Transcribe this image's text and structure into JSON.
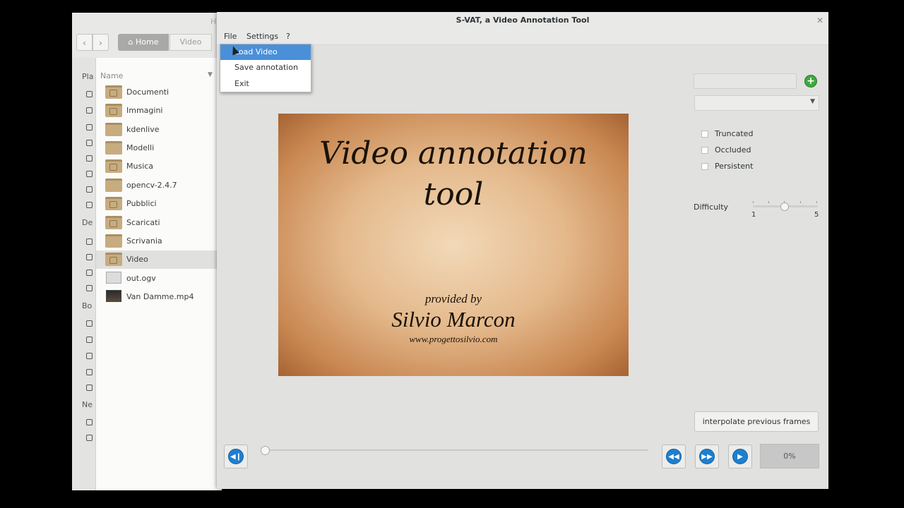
{
  "file_manager": {
    "title_fragment": "H",
    "back_icon": "chevron-left-icon",
    "forward_icon": "chevron-right-icon",
    "path": [
      "Home",
      "Video"
    ],
    "sidebar_sections": [
      "Pla",
      "De",
      "Bo",
      "Ne"
    ],
    "column_header": "Name",
    "items": [
      {
        "name": "Documenti",
        "type": "folder"
      },
      {
        "name": "Immagini",
        "type": "folder"
      },
      {
        "name": "kdenlive",
        "type": "folder"
      },
      {
        "name": "Modelli",
        "type": "folder"
      },
      {
        "name": "Musica",
        "type": "folder"
      },
      {
        "name": "opencv-2.4.7",
        "type": "folder"
      },
      {
        "name": "Pubblici",
        "type": "folder"
      },
      {
        "name": "Scaricati",
        "type": "folder"
      },
      {
        "name": "Scrivania",
        "type": "folder"
      },
      {
        "name": "Video",
        "type": "folder",
        "selected": true
      },
      {
        "name": "out.ogv",
        "type": "file"
      },
      {
        "name": "Van Damme.mp4",
        "type": "video"
      }
    ]
  },
  "app": {
    "title": "S-VAT, a Video Annotation Tool",
    "close_icon": "close-icon",
    "menu": [
      "File",
      "Settings",
      "?"
    ],
    "file_menu": [
      "Load Video",
      "Save annotation",
      "Exit"
    ],
    "file_menu_highlighted": "Load Video"
  },
  "video": {
    "title": "Video annotation\ntool",
    "provided_by": "provided by",
    "author": "Silvio Marcon",
    "url": "www.progettosilvio.com"
  },
  "panel": {
    "label_value": "",
    "add_icon": "plus-circle-icon",
    "class_value": "",
    "checkboxes": [
      {
        "label": "Truncated",
        "checked": false
      },
      {
        "label": "Occluded",
        "checked": false
      },
      {
        "label": "Persistent",
        "checked": false
      }
    ],
    "difficulty_label": "Difficulty",
    "difficulty_min": "1",
    "difficulty_max": "5",
    "difficulty_value": 3,
    "interpolate_label": "interpolate previous frames"
  },
  "controls": {
    "first_frame_icon": "skip-back-icon",
    "rewind_icon": "rewind-icon",
    "fast_forward_icon": "fast-forward-icon",
    "play_icon": "play-icon",
    "seek_position": 0,
    "progress_text": "0%",
    "progress_value": 0
  },
  "colors": {
    "accent": "#4a90d9",
    "control_blue": "#1e7fcf",
    "add_green": "#3daa3d"
  }
}
